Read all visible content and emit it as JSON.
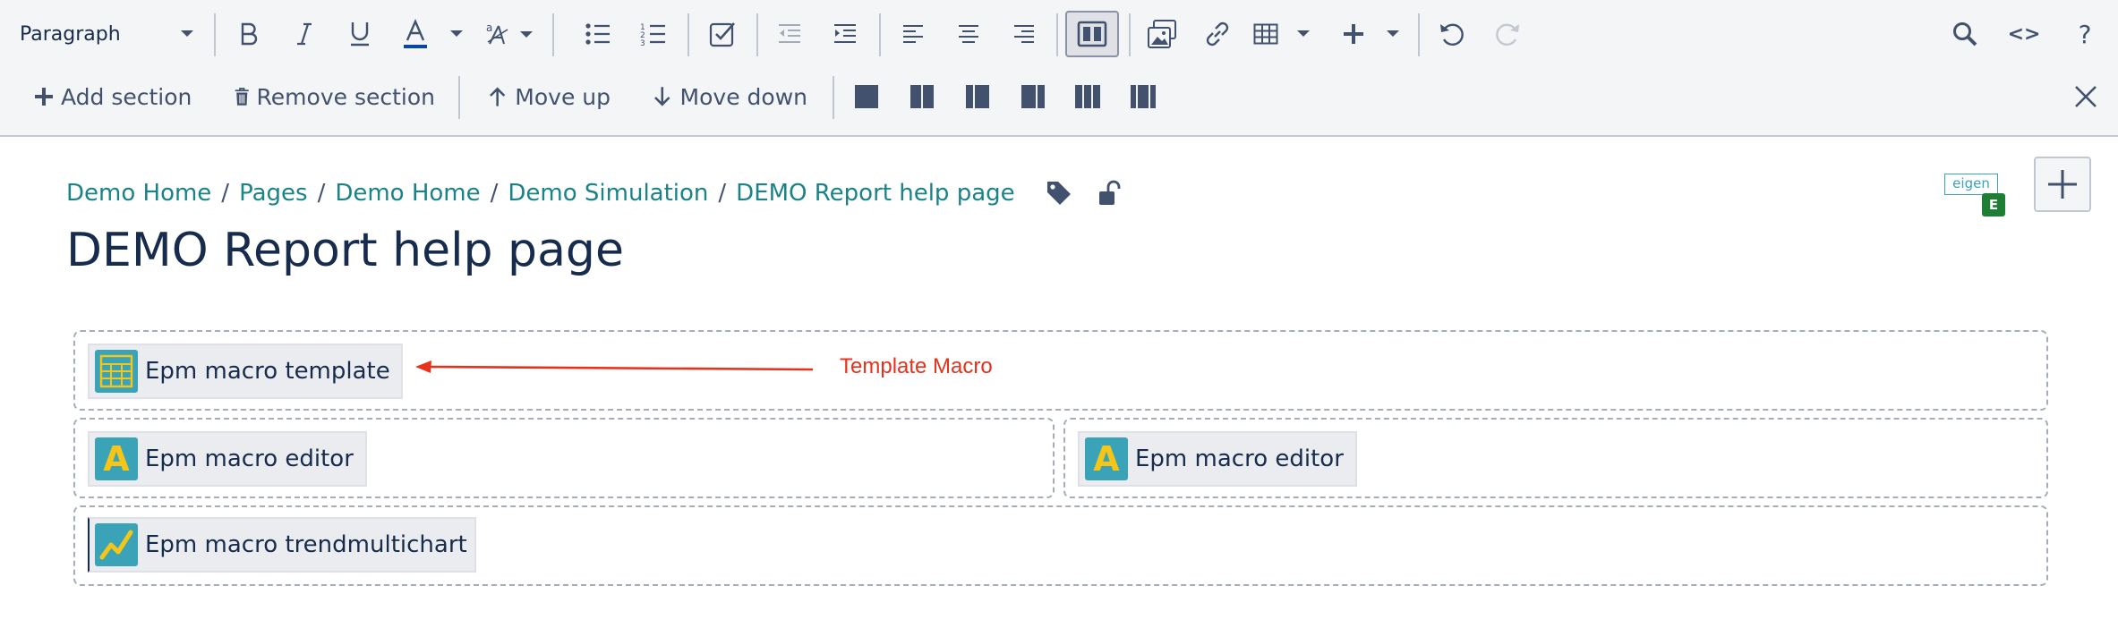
{
  "toolbar": {
    "paragraph_select": "Paragraph",
    "add_section": "Add section",
    "remove_section": "Remove section",
    "move_up": "Move up",
    "move_down": "Move down",
    "source_label": "<>",
    "help_label": "?"
  },
  "breadcrumb": [
    "Demo Home",
    "Pages",
    "Demo Home",
    "Demo Simulation",
    "DEMO Report help page"
  ],
  "breadcrumb_separator": "/",
  "page_title": "DEMO Report help page",
  "eigen_logo": {
    "text": "eigen",
    "badge": "E"
  },
  "sections": [
    {
      "macros": [
        {
          "label": "Epm macro template",
          "icon": "template-grid-icon"
        }
      ]
    },
    {
      "columns": [
        {
          "macros": [
            {
              "label": "Epm macro editor",
              "icon": "letter-a-icon",
              "icon_text": "A"
            }
          ]
        },
        {
          "macros": [
            {
              "label": "Epm macro editor",
              "icon": "letter-a-icon",
              "icon_text": "A"
            }
          ]
        }
      ]
    },
    {
      "macros": [
        {
          "label": "Epm macro trendmultichart",
          "icon": "trend-chart-icon"
        }
      ]
    }
  ],
  "annotation": {
    "text": "Template Macro",
    "color": "#e8311a"
  },
  "colors": {
    "link": "#1a8387",
    "macro_icon_bg": "#3aa3b8",
    "toolbar_bg": "#f4f5f7",
    "badge_green": "#1e7e34"
  }
}
